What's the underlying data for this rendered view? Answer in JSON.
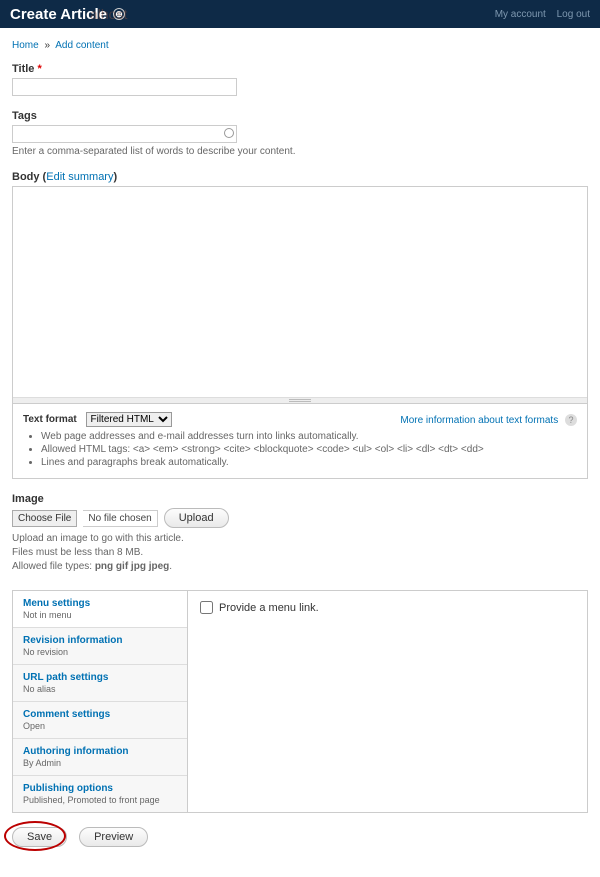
{
  "topbar": {
    "title": "Create Article",
    "ghost": "alhost",
    "links": {
      "account": "My account",
      "logout": "Log out"
    }
  },
  "breadcrumb": {
    "home": "Home",
    "sep": "»",
    "add": "Add content"
  },
  "title_field": {
    "label": "Title",
    "value": ""
  },
  "tags": {
    "label": "Tags",
    "value": "",
    "help": "Enter a comma-separated list of words to describe your content."
  },
  "body": {
    "label": "Body",
    "edit_summary": "Edit summary",
    "value": "",
    "format_label": "Text format",
    "format_value": "Filtered HTML",
    "more_info": "More information about text formats",
    "tips": [
      "Web page addresses and e-mail addresses turn into links automatically.",
      "Allowed HTML tags: <a> <em> <strong> <cite> <blockquote> <code> <ul> <ol> <li> <dl> <dt> <dd>",
      "Lines and paragraphs break automatically."
    ]
  },
  "image": {
    "label": "Image",
    "choose": "Choose File",
    "nofile": "No file chosen",
    "upload": "Upload",
    "help1": "Upload an image to go with this article.",
    "help2": "Files must be less than 8 MB.",
    "help3_prefix": "Allowed file types: ",
    "help3_types": "png gif jpg jpeg"
  },
  "vtabs": {
    "items": [
      {
        "title": "Menu settings",
        "sub": "Not in menu"
      },
      {
        "title": "Revision information",
        "sub": "No revision"
      },
      {
        "title": "URL path settings",
        "sub": "No alias"
      },
      {
        "title": "Comment settings",
        "sub": "Open"
      },
      {
        "title": "Authoring information",
        "sub": "By Admin"
      },
      {
        "title": "Publishing options",
        "sub": "Published, Promoted to front page"
      }
    ],
    "menu_checkbox": "Provide a menu link."
  },
  "actions": {
    "save": "Save",
    "preview": "Preview"
  }
}
